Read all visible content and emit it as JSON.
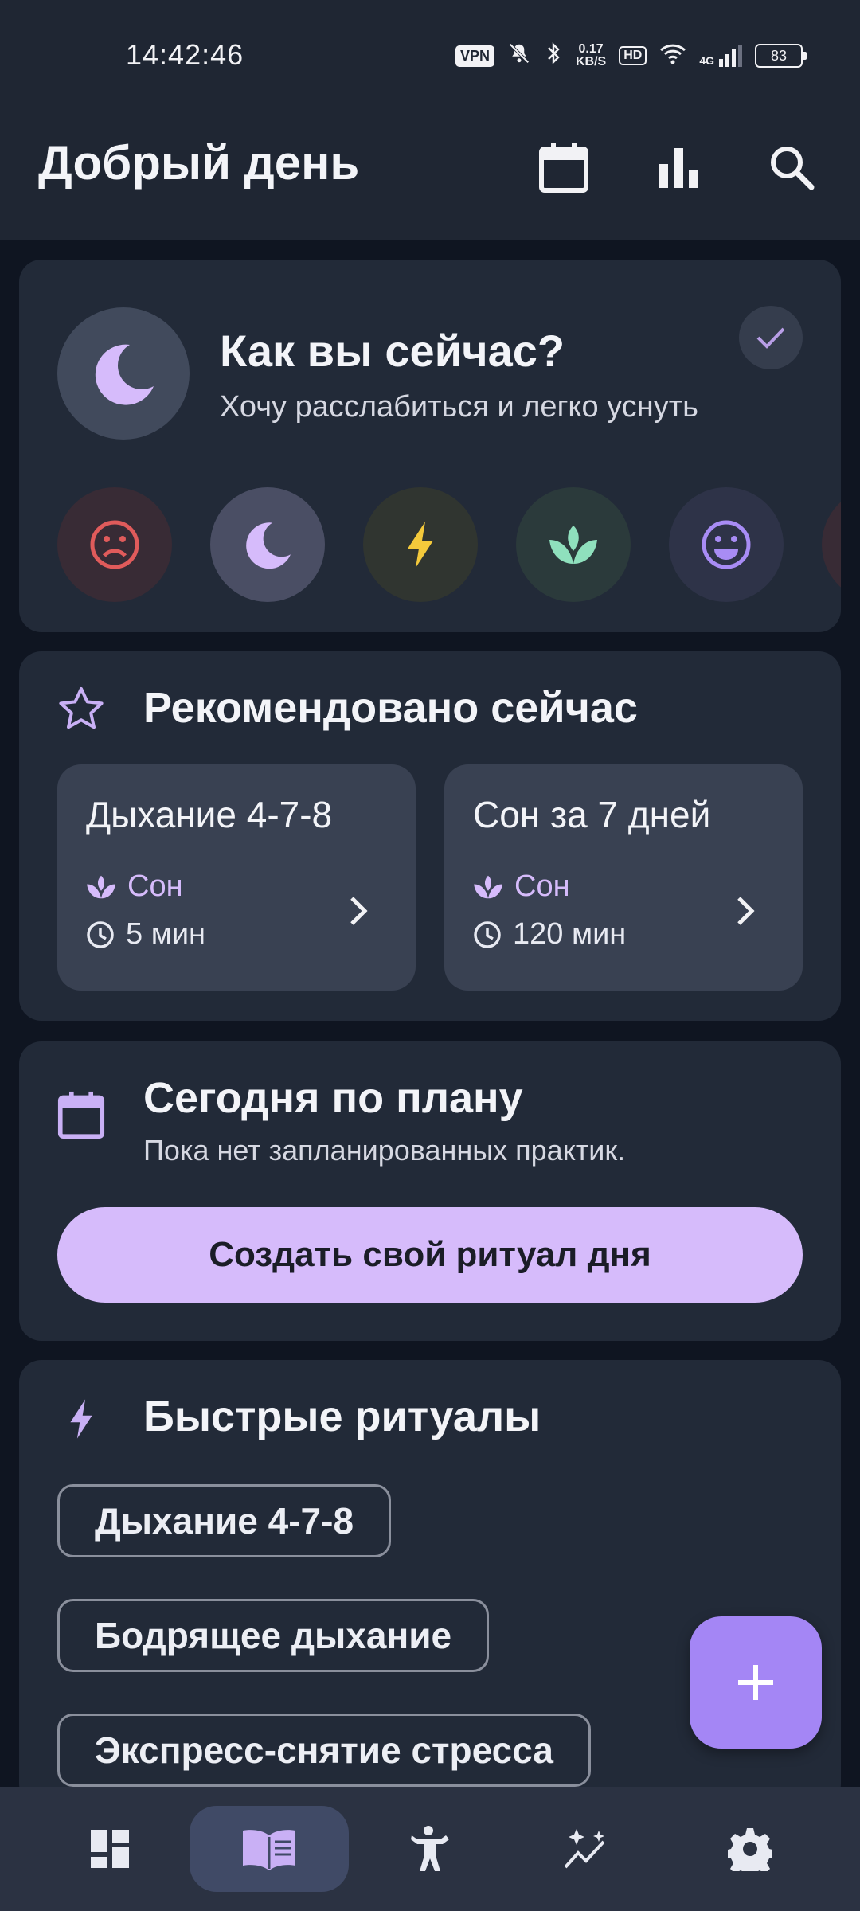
{
  "status_bar": {
    "time": "14:42:46",
    "vpn": "VPN",
    "speed_value": "0.17",
    "speed_unit": "KB/S",
    "hd": "HD",
    "network": "4G",
    "battery": "83"
  },
  "header": {
    "title": "Добрый день",
    "icons": [
      "calendar-icon",
      "bar-chart-icon",
      "search-icon"
    ]
  },
  "mood": {
    "title": "Как вы сейчас?",
    "subtitle": "Хочу расслабиться и легко уснуть",
    "options": [
      "sad-face-icon",
      "moon-icon",
      "lightning-icon",
      "lotus-icon",
      "happy-face-icon"
    ],
    "selected": "moon-icon"
  },
  "recommended": {
    "title": "Рекомендовано сейчас",
    "items": [
      {
        "title": "Дыхание 4-7-8",
        "category": "Сон",
        "duration": "5 мин"
      },
      {
        "title": "Сон за 7 дней",
        "category": "Сон",
        "duration": "120 мин"
      }
    ]
  },
  "plan": {
    "title": "Сегодня по плану",
    "subtitle": "Пока нет запланированных практик.",
    "button_label": "Создать свой ритуал дня"
  },
  "quick": {
    "title": "Быстрые ритуалы",
    "items": [
      "Дыхание 4-7-8",
      "Бодрящее дыхание",
      "Экспресс-снятие стресса"
    ]
  },
  "fab_icon": "plus-icon",
  "bottom_nav": {
    "items": [
      "dashboard-icon",
      "book-icon",
      "meditation-icon",
      "sparkle-chart-icon",
      "settings-icon"
    ],
    "active": "book-icon"
  },
  "colors": {
    "background": "#0f1521",
    "card": "#222a38",
    "accent": "#d6bbfb",
    "fab": "#a486f5"
  }
}
